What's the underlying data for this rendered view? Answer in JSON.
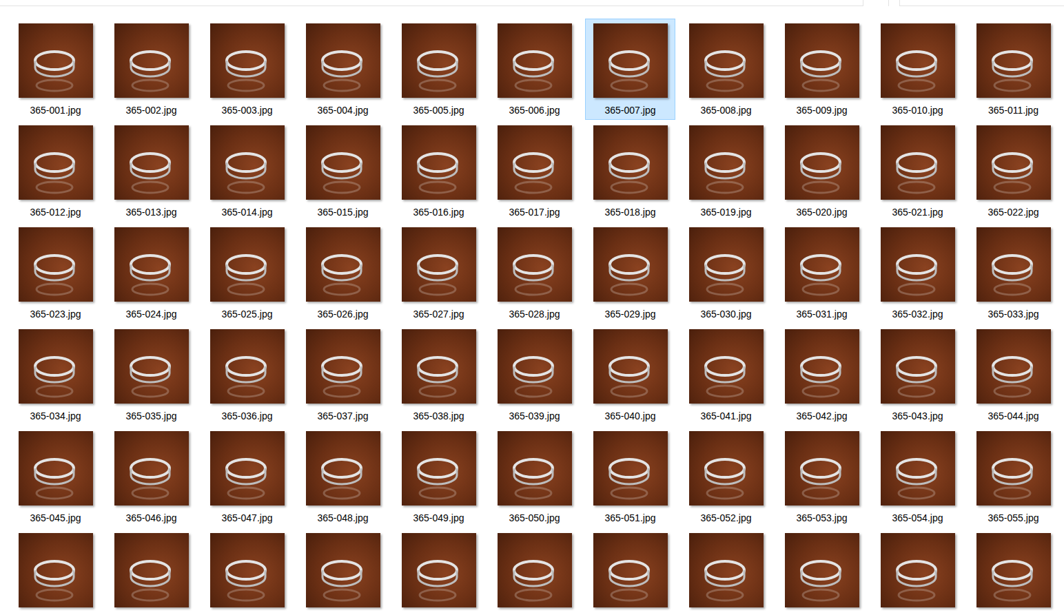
{
  "window": {
    "view": "large-icons"
  },
  "files": [
    {
      "label": "365-001.jpg",
      "selected": false
    },
    {
      "label": "365-002.jpg",
      "selected": false
    },
    {
      "label": "365-003.jpg",
      "selected": false
    },
    {
      "label": "365-004.jpg",
      "selected": false
    },
    {
      "label": "365-005.jpg",
      "selected": false
    },
    {
      "label": "365-006.jpg",
      "selected": false
    },
    {
      "label": "365-007.jpg",
      "selected": true
    },
    {
      "label": "365-008.jpg",
      "selected": false
    },
    {
      "label": "365-009.jpg",
      "selected": false
    },
    {
      "label": "365-010.jpg",
      "selected": false
    },
    {
      "label": "365-011.jpg",
      "selected": false
    },
    {
      "label": "365-012.jpg",
      "selected": false
    },
    {
      "label": "365-013.jpg",
      "selected": false
    },
    {
      "label": "365-014.jpg",
      "selected": false
    },
    {
      "label": "365-015.jpg",
      "selected": false
    },
    {
      "label": "365-016.jpg",
      "selected": false
    },
    {
      "label": "365-017.jpg",
      "selected": false
    },
    {
      "label": "365-018.jpg",
      "selected": false
    },
    {
      "label": "365-019.jpg",
      "selected": false
    },
    {
      "label": "365-020.jpg",
      "selected": false
    },
    {
      "label": "365-021.jpg",
      "selected": false
    },
    {
      "label": "365-022.jpg",
      "selected": false
    },
    {
      "label": "365-023.jpg",
      "selected": false
    },
    {
      "label": "365-024.jpg",
      "selected": false
    },
    {
      "label": "365-025.jpg",
      "selected": false
    },
    {
      "label": "365-026.jpg",
      "selected": false
    },
    {
      "label": "365-027.jpg",
      "selected": false
    },
    {
      "label": "365-028.jpg",
      "selected": false
    },
    {
      "label": "365-029.jpg",
      "selected": false
    },
    {
      "label": "365-030.jpg",
      "selected": false
    },
    {
      "label": "365-031.jpg",
      "selected": false
    },
    {
      "label": "365-032.jpg",
      "selected": false
    },
    {
      "label": "365-033.jpg",
      "selected": false
    },
    {
      "label": "365-034.jpg",
      "selected": false
    },
    {
      "label": "365-035.jpg",
      "selected": false
    },
    {
      "label": "365-036.jpg",
      "selected": false
    },
    {
      "label": "365-037.jpg",
      "selected": false
    },
    {
      "label": "365-038.jpg",
      "selected": false
    },
    {
      "label": "365-039.jpg",
      "selected": false
    },
    {
      "label": "365-040.jpg",
      "selected": false
    },
    {
      "label": "365-041.jpg",
      "selected": false
    },
    {
      "label": "365-042.jpg",
      "selected": false
    },
    {
      "label": "365-043.jpg",
      "selected": false
    },
    {
      "label": "365-044.jpg",
      "selected": false
    },
    {
      "label": "365-045.jpg",
      "selected": false
    },
    {
      "label": "365-046.jpg",
      "selected": false
    },
    {
      "label": "365-047.jpg",
      "selected": false
    },
    {
      "label": "365-048.jpg",
      "selected": false
    },
    {
      "label": "365-049.jpg",
      "selected": false
    },
    {
      "label": "365-050.jpg",
      "selected": false
    },
    {
      "label": "365-051.jpg",
      "selected": false
    },
    {
      "label": "365-052.jpg",
      "selected": false
    },
    {
      "label": "365-053.jpg",
      "selected": false
    },
    {
      "label": "365-054.jpg",
      "selected": false
    },
    {
      "label": "365-055.jpg",
      "selected": false
    },
    {
      "label": "",
      "selected": false
    },
    {
      "label": "",
      "selected": false
    },
    {
      "label": "",
      "selected": false
    },
    {
      "label": "",
      "selected": false
    },
    {
      "label": "",
      "selected": false
    },
    {
      "label": "",
      "selected": false
    },
    {
      "label": "",
      "selected": false
    },
    {
      "label": "",
      "selected": false
    },
    {
      "label": "",
      "selected": false
    },
    {
      "label": "",
      "selected": false
    },
    {
      "label": "",
      "selected": false
    }
  ]
}
